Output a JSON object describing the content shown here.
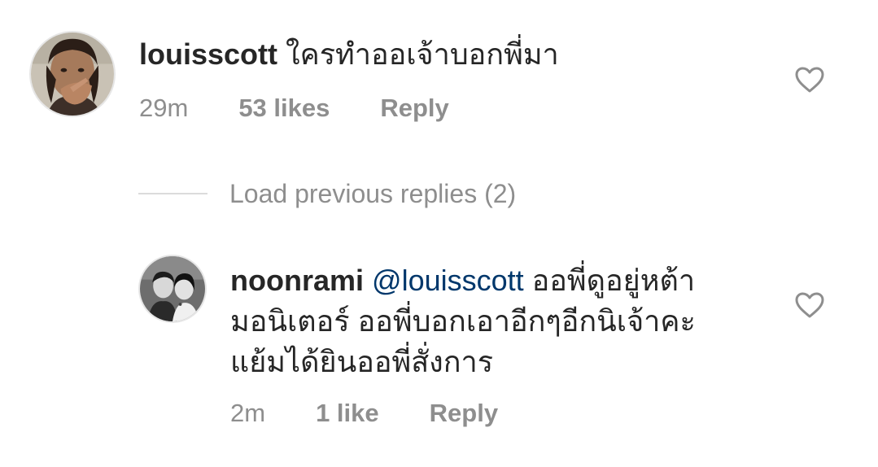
{
  "comment": {
    "username": "louisscott",
    "text": "ใครทำออเจ้าบอกพี่มา",
    "time": "29m",
    "likes": "53 likes",
    "reply_label": "Reply",
    "avatar_icon": "profile-photo-man-pointing"
  },
  "load_previous": {
    "label": "Load previous replies (2)"
  },
  "reply": {
    "username": "noonrami",
    "mention": "@louisscott",
    "text_line1": "ออพี่ดูอยู่หต้า",
    "text_line2": "มอนิเตอร์ ออพี่บอกเอาอีกๆอีกนิเจ้าคะ",
    "text_line3": "แย้มได้ยินออพี่สั่งการ",
    "time": "2m",
    "likes": "1 like",
    "reply_label": "Reply",
    "avatar_icon": "profile-photo-couple"
  },
  "icons": {
    "like": "heart-outline-icon"
  },
  "colors": {
    "text": "#262626",
    "meta": "#8e8e8e",
    "mention": "#00376b",
    "divider": "#dbdbdb"
  }
}
